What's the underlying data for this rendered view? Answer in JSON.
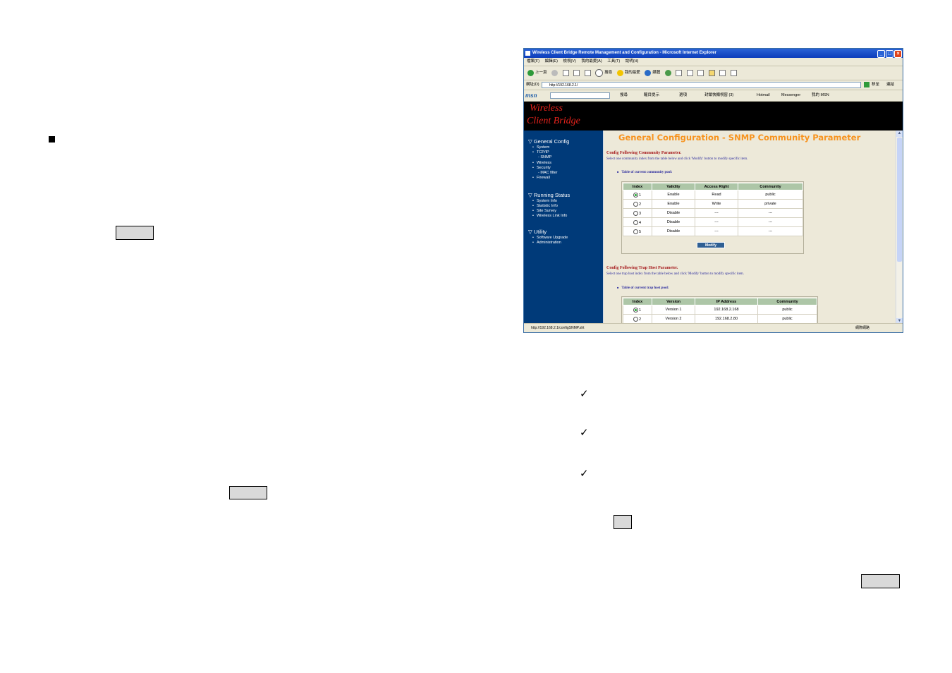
{
  "left_column": {
    "bullet_glyph": "■",
    "button_1_label": "",
    "button_2_label": ""
  },
  "right_column": {
    "checks": [
      "✓",
      "✓",
      "✓"
    ],
    "small_button_label": "",
    "button_label": ""
  },
  "browser": {
    "window_title": "Wireless Client Bridge Remote Management and Configuration - Microsoft Internet Explorer",
    "menu": [
      "檔案(F)",
      "編輯(E)",
      "檢視(V)",
      "我的最愛(A)",
      "工具(T)",
      "說明(H)"
    ],
    "toolbar": {
      "back": "上一頁",
      "search": "搜尋",
      "favorites": "我的最愛",
      "media": "媒體"
    },
    "address_label": "網址(D)",
    "address_value": "http://192.168.2.1/",
    "go_label": "移至",
    "links_label": "連結",
    "msn": {
      "logo": "msn",
      "search": "搜尋",
      "highlight": "醒目提示",
      "options": "選項",
      "popup": "封鎖快顯視窗 (3)",
      "hotmail": "Hotmail",
      "messenger": "Messenger",
      "my_msn": "我的 MSN"
    },
    "banner": {
      "line1": "Wireless",
      "line2": "Client Bridge"
    },
    "sidebar": {
      "general_config": "▽ General Config",
      "general_items": [
        "System",
        "TCP/IP",
        "SNMP",
        "Wireless",
        "Security",
        "MAC filter",
        "Firewall"
      ],
      "running_status": "▽ Running Status",
      "running_items": [
        "System Info",
        "Statistic Info",
        "Site Survey",
        "Wireless Link Info"
      ],
      "utility": "▽ Utility",
      "utility_items": [
        "Software Upgrade",
        "Administration"
      ]
    },
    "content": {
      "page_title": "General Configuration - SNMP Community Parameter",
      "community_section_title": "Config Following Community Parameter.",
      "community_section_desc": "Select one community index from the table below and click 'Modify' button to modify specific item.",
      "community_table_caption": "Table of current community pool:",
      "community_headers": [
        "Index",
        "Validity",
        "Access Right",
        "Community"
      ],
      "community_rows": [
        {
          "index": "1",
          "selected": true,
          "validity": "Enable",
          "access": "Read",
          "community": "public"
        },
        {
          "index": "2",
          "selected": false,
          "validity": "Enable",
          "access": "Write",
          "community": "private"
        },
        {
          "index": "3",
          "selected": false,
          "validity": "Disable",
          "access": "---",
          "community": "---"
        },
        {
          "index": "4",
          "selected": false,
          "validity": "Disable",
          "access": "---",
          "community": "---"
        },
        {
          "index": "5",
          "selected": false,
          "validity": "Disable",
          "access": "---",
          "community": "---"
        }
      ],
      "modify_label": "Modify",
      "trap_section_title": "Config Following Trap Host Parameter.",
      "trap_section_desc": "Select one trap host index from the table below and click 'Modify' button to modify specific item.",
      "trap_table_caption": "Table of current trap host pool:",
      "trap_headers": [
        "Index",
        "Version",
        "IP Address",
        "Community"
      ],
      "trap_rows": [
        {
          "index": "1",
          "selected": true,
          "version": "Version 1",
          "ip": "192.168.2.168",
          "community": "public"
        },
        {
          "index": "2",
          "selected": false,
          "version": "Version 2",
          "ip": "192.168.2.80",
          "community": "public"
        }
      ]
    },
    "status_url": "http://192.168.2.1/configSNMP.sht",
    "status_zone": "網際網路"
  }
}
